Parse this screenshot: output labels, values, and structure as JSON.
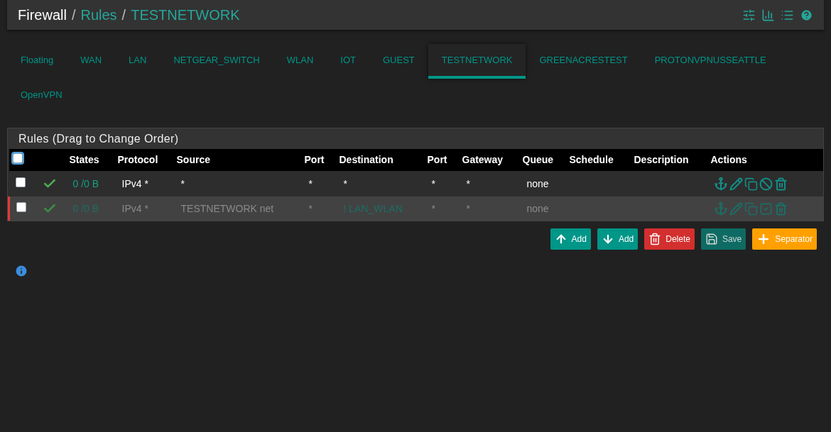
{
  "breadcrumb": [
    {
      "label": "Firewall",
      "link": false
    },
    {
      "separator": "/",
      "label": "Rules",
      "link": true
    },
    {
      "separator": "/",
      "label": "TESTNETWORK",
      "link": true
    }
  ],
  "tabs": [
    {
      "label": "Floating",
      "selected": false
    },
    {
      "label": "WAN",
      "selected": false
    },
    {
      "label": "LAN",
      "selected": false
    },
    {
      "label": "NETGEAR_SWITCH",
      "selected": false
    },
    {
      "label": "WLAN",
      "selected": false
    },
    {
      "label": "IOT",
      "selected": false
    },
    {
      "label": "GUEST",
      "selected": false
    },
    {
      "label": "TESTNETWORK",
      "selected": true
    },
    {
      "label": "GREENACRESTEST",
      "selected": false
    },
    {
      "label": "PROTONVPNUSSEATTLE",
      "selected": false
    },
    {
      "label": "OpenVPN",
      "selected": false
    }
  ],
  "panel": {
    "title": "Rules (Drag to Change Order)",
    "select_all": {
      "checked": false
    },
    "columns": [
      "States",
      "Protocol",
      "Source",
      "Port",
      "Destination",
      "Port",
      "Gateway",
      "Queue",
      "Schedule",
      "Description",
      "Actions"
    ],
    "rows": [
      {
        "checked": false,
        "disabled": false,
        "states": "0 /0 B",
        "protocol": "IPv4 *",
        "source": "*",
        "source_port": "*",
        "destination": "*",
        "destination_alias": false,
        "destination_port": "*",
        "gateway": "*",
        "queue": "none"
      },
      {
        "checked": false,
        "disabled": true,
        "states": "0 /0 B",
        "protocol": "IPv4 *",
        "source": "TESTNETWORK net",
        "source_port": "*",
        "destination": "! LAN_WLAN",
        "destination_alias": true,
        "destination_port": "*",
        "gateway": "*",
        "queue": "none"
      }
    ]
  },
  "buttons": [
    {
      "kind": "add_top",
      "label": "Add"
    },
    {
      "kind": "add_bottom",
      "label": "Add"
    },
    {
      "kind": "delete",
      "label": "Delete"
    },
    {
      "kind": "save",
      "label": "Save"
    },
    {
      "kind": "separator",
      "label": "Separator"
    }
  ]
}
